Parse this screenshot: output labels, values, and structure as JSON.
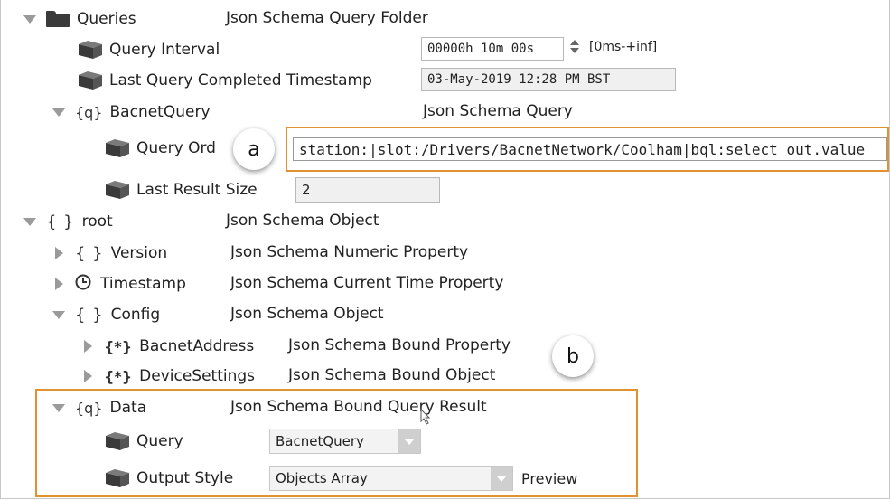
{
  "rows": {
    "queries": {
      "label": "Queries",
      "type": "Json Schema Query Folder"
    },
    "query_interval": {
      "label": "Query Interval",
      "value": "00000h 10m 00s",
      "range": "[0ms-+inf]"
    },
    "last_query": {
      "label": "Last Query Completed Timestamp",
      "value": "03-May-2019 12:28 PM BST"
    },
    "bacnet_query": {
      "label": "BacnetQuery",
      "type": "Json Schema Query"
    },
    "query_ord": {
      "label": "Query Ord",
      "value": "station:|slot:/Drivers/BacnetNetwork/Coolham|bql:select out.value"
    },
    "last_result_size": {
      "label": "Last Result Size",
      "value": "2"
    },
    "root": {
      "label": "root",
      "type": "Json Schema Object"
    },
    "version": {
      "label": "Version",
      "type": "Json Schema Numeric Property"
    },
    "timestamp": {
      "label": "Timestamp",
      "type": "Json Schema Current Time Property"
    },
    "config": {
      "label": "Config",
      "type": "Json Schema Object"
    },
    "bacnet_address": {
      "label": "BacnetAddress",
      "type": "Json Schema Bound Property"
    },
    "device_settings": {
      "label": "DeviceSettings",
      "type": "Json Schema Bound Object"
    },
    "data": {
      "label": "Data",
      "type": "Json Schema Bound Query Result"
    },
    "query": {
      "label": "Query",
      "value": "BacnetQuery"
    },
    "output_style": {
      "label": "Output Style",
      "value": "Objects Array",
      "preview": "Preview"
    }
  },
  "glyphs": {
    "brace": "{ }",
    "query": "{q}",
    "bound": "{*}"
  },
  "callouts": {
    "a": "a",
    "b": "b"
  },
  "colors": {
    "highlight": "#e1922e"
  }
}
